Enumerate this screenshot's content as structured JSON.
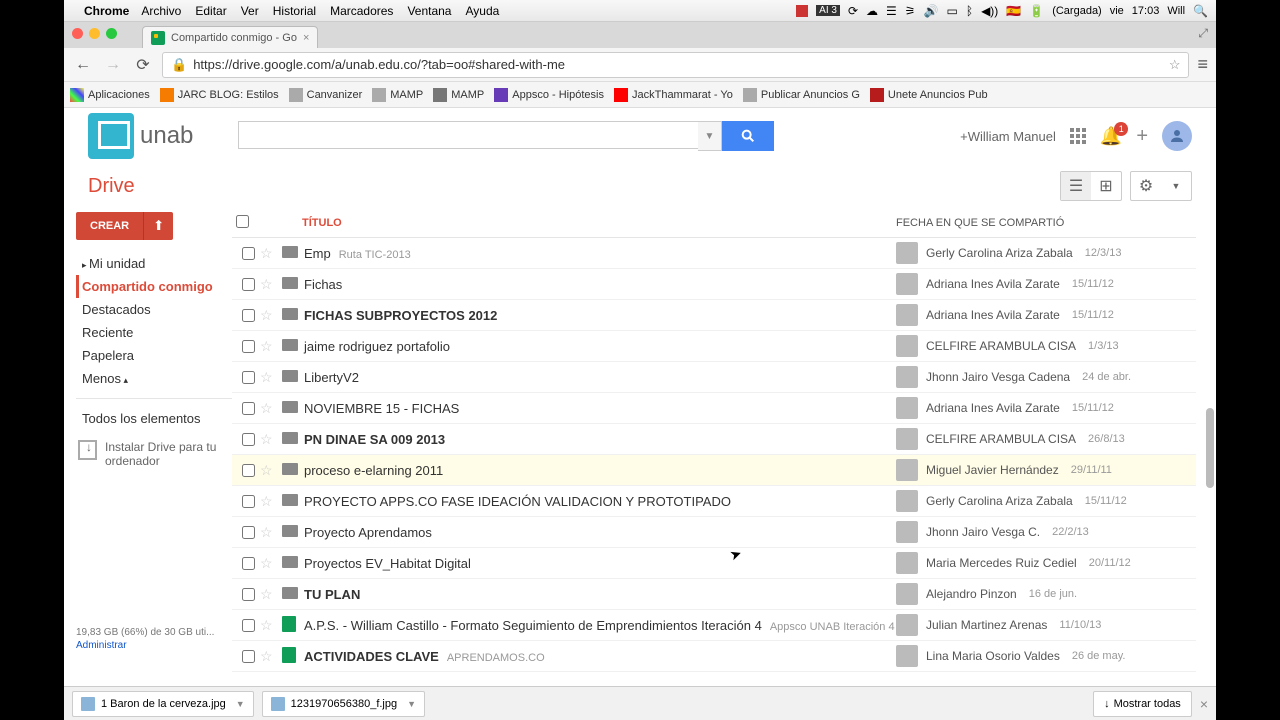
{
  "menubar": {
    "app": "Chrome",
    "items": [
      "Archivo",
      "Editar",
      "Ver",
      "Historial",
      "Marcadores",
      "Ventana",
      "Ayuda"
    ],
    "right": {
      "ai": "AI 3",
      "battery": "(Cargada)",
      "day": "vie",
      "time": "17:03",
      "user": "Will"
    }
  },
  "tab": {
    "title": "Compartido conmigo - Go"
  },
  "url": "https://drive.google.com/a/unab.edu.co/?tab=oo#shared-with-me",
  "bookmarks": [
    {
      "label": "Aplicaciones",
      "color": "#f4b400"
    },
    {
      "label": "JARC BLOG: Estilos",
      "color": "#f57c00"
    },
    {
      "label": "Canvanizer",
      "color": "#aaa"
    },
    {
      "label": "MAMP",
      "color": "#aaa"
    },
    {
      "label": "MAMP",
      "color": "#777"
    },
    {
      "label": "Appsco - Hipótesis",
      "color": "#673ab7"
    },
    {
      "label": "JackThammarat - Yo",
      "color": "#f00"
    },
    {
      "label": "Publicar Anuncios G",
      "color": "#aaa"
    },
    {
      "label": "Unete Anuncios Pub",
      "color": "#b71c1c"
    }
  ],
  "logo": "unab",
  "user_link": "+William Manuel",
  "bell_count": "1",
  "drive_title": "Drive",
  "create_label": "CREAR",
  "nav": {
    "mi_unidad": "Mi unidad",
    "compartido": "Compartido conmigo",
    "destacados": "Destacados",
    "reciente": "Reciente",
    "papelera": "Papelera",
    "menos": "Menos",
    "todos": "Todos los elementos",
    "instalar": "Instalar Drive para tu ordenador"
  },
  "storage": {
    "text": "19,83 GB (66%) de 30 GB uti...",
    "link": "Administrar"
  },
  "headers": {
    "titulo": "TÍTULO",
    "fecha": "FECHA EN QUE SE COMPARTIÓ"
  },
  "rows": [
    {
      "type": "folder",
      "name": "Emp",
      "sub": "Ruta TIC-2013",
      "bold": false,
      "owner": "Gerly Carolina Ariza Zabala",
      "date": "12/3/13",
      "hl": false
    },
    {
      "type": "folder",
      "name": "Fichas",
      "sub": "",
      "bold": false,
      "owner": "Adriana Ines Avila Zarate",
      "date": "15/11/12",
      "hl": false
    },
    {
      "type": "folder",
      "name": "FICHAS SUBPROYECTOS 2012",
      "sub": "",
      "bold": true,
      "owner": "Adriana Ines Avila Zarate",
      "date": "15/11/12",
      "hl": false
    },
    {
      "type": "folder",
      "name": "jaime rodriguez portafolio",
      "sub": "",
      "bold": false,
      "owner": "CELFIRE ARAMBULA CISA",
      "date": "1/3/13",
      "hl": false
    },
    {
      "type": "folder",
      "name": "LibertyV2",
      "sub": "",
      "bold": false,
      "owner": "Jhonn Jairo Vesga Cadena",
      "date": "24 de abr.",
      "hl": false
    },
    {
      "type": "folder",
      "name": "NOVIEMBRE 15 - FICHAS",
      "sub": "",
      "bold": false,
      "owner": "Adriana Ines Avila Zarate",
      "date": "15/11/12",
      "hl": false
    },
    {
      "type": "folder",
      "name": "PN DINAE SA 009 2013",
      "sub": "",
      "bold": true,
      "owner": "CELFIRE ARAMBULA CISA",
      "date": "26/8/13",
      "hl": false
    },
    {
      "type": "folder",
      "name": "proceso e-elarning 2011",
      "sub": "",
      "bold": false,
      "owner": "Miguel Javier Hernández",
      "date": "29/11/11",
      "hl": true
    },
    {
      "type": "folder",
      "name": "PROYECTO APPS.CO FASE IDEACIÓN VALIDACION Y PROTOTIPADO",
      "sub": "",
      "bold": false,
      "owner": "Gerly Carolina Ariza Zabala",
      "date": "15/11/12",
      "hl": false
    },
    {
      "type": "folder",
      "name": "Proyecto Aprendamos",
      "sub": "",
      "bold": false,
      "owner": "Jhonn Jairo Vesga C.",
      "date": "22/2/13",
      "hl": false
    },
    {
      "type": "folder",
      "name": "Proyectos EV_Habitat Digital",
      "sub": "",
      "bold": false,
      "owner": "Maria Mercedes Ruiz Cediel",
      "date": "20/11/12",
      "hl": false
    },
    {
      "type": "folder",
      "name": "TU PLAN",
      "sub": "",
      "bold": true,
      "owner": "Alejandro Pinzon",
      "date": "16 de jun.",
      "hl": false
    },
    {
      "type": "sheet",
      "name": "A.P.S. - William Castillo - Formato Seguimiento de Emprendimientos Iteración 4",
      "sub": "Appsco UNAB Iteración 4",
      "bold": false,
      "owner": "Julian Martinez Arenas",
      "date": "11/10/13",
      "hl": false
    },
    {
      "type": "sheet",
      "name": "ACTIVIDADES CLAVE",
      "sub": "APRENDAMOS.CO",
      "bold": true,
      "owner": "Lina Maria Osorio Valdes",
      "date": "26 de may.",
      "hl": false
    }
  ],
  "downloads": {
    "items": [
      "1 Baron de la cerveza.jpg",
      "1231970656380_f.jpg"
    ],
    "showall": "Mostrar todas"
  }
}
